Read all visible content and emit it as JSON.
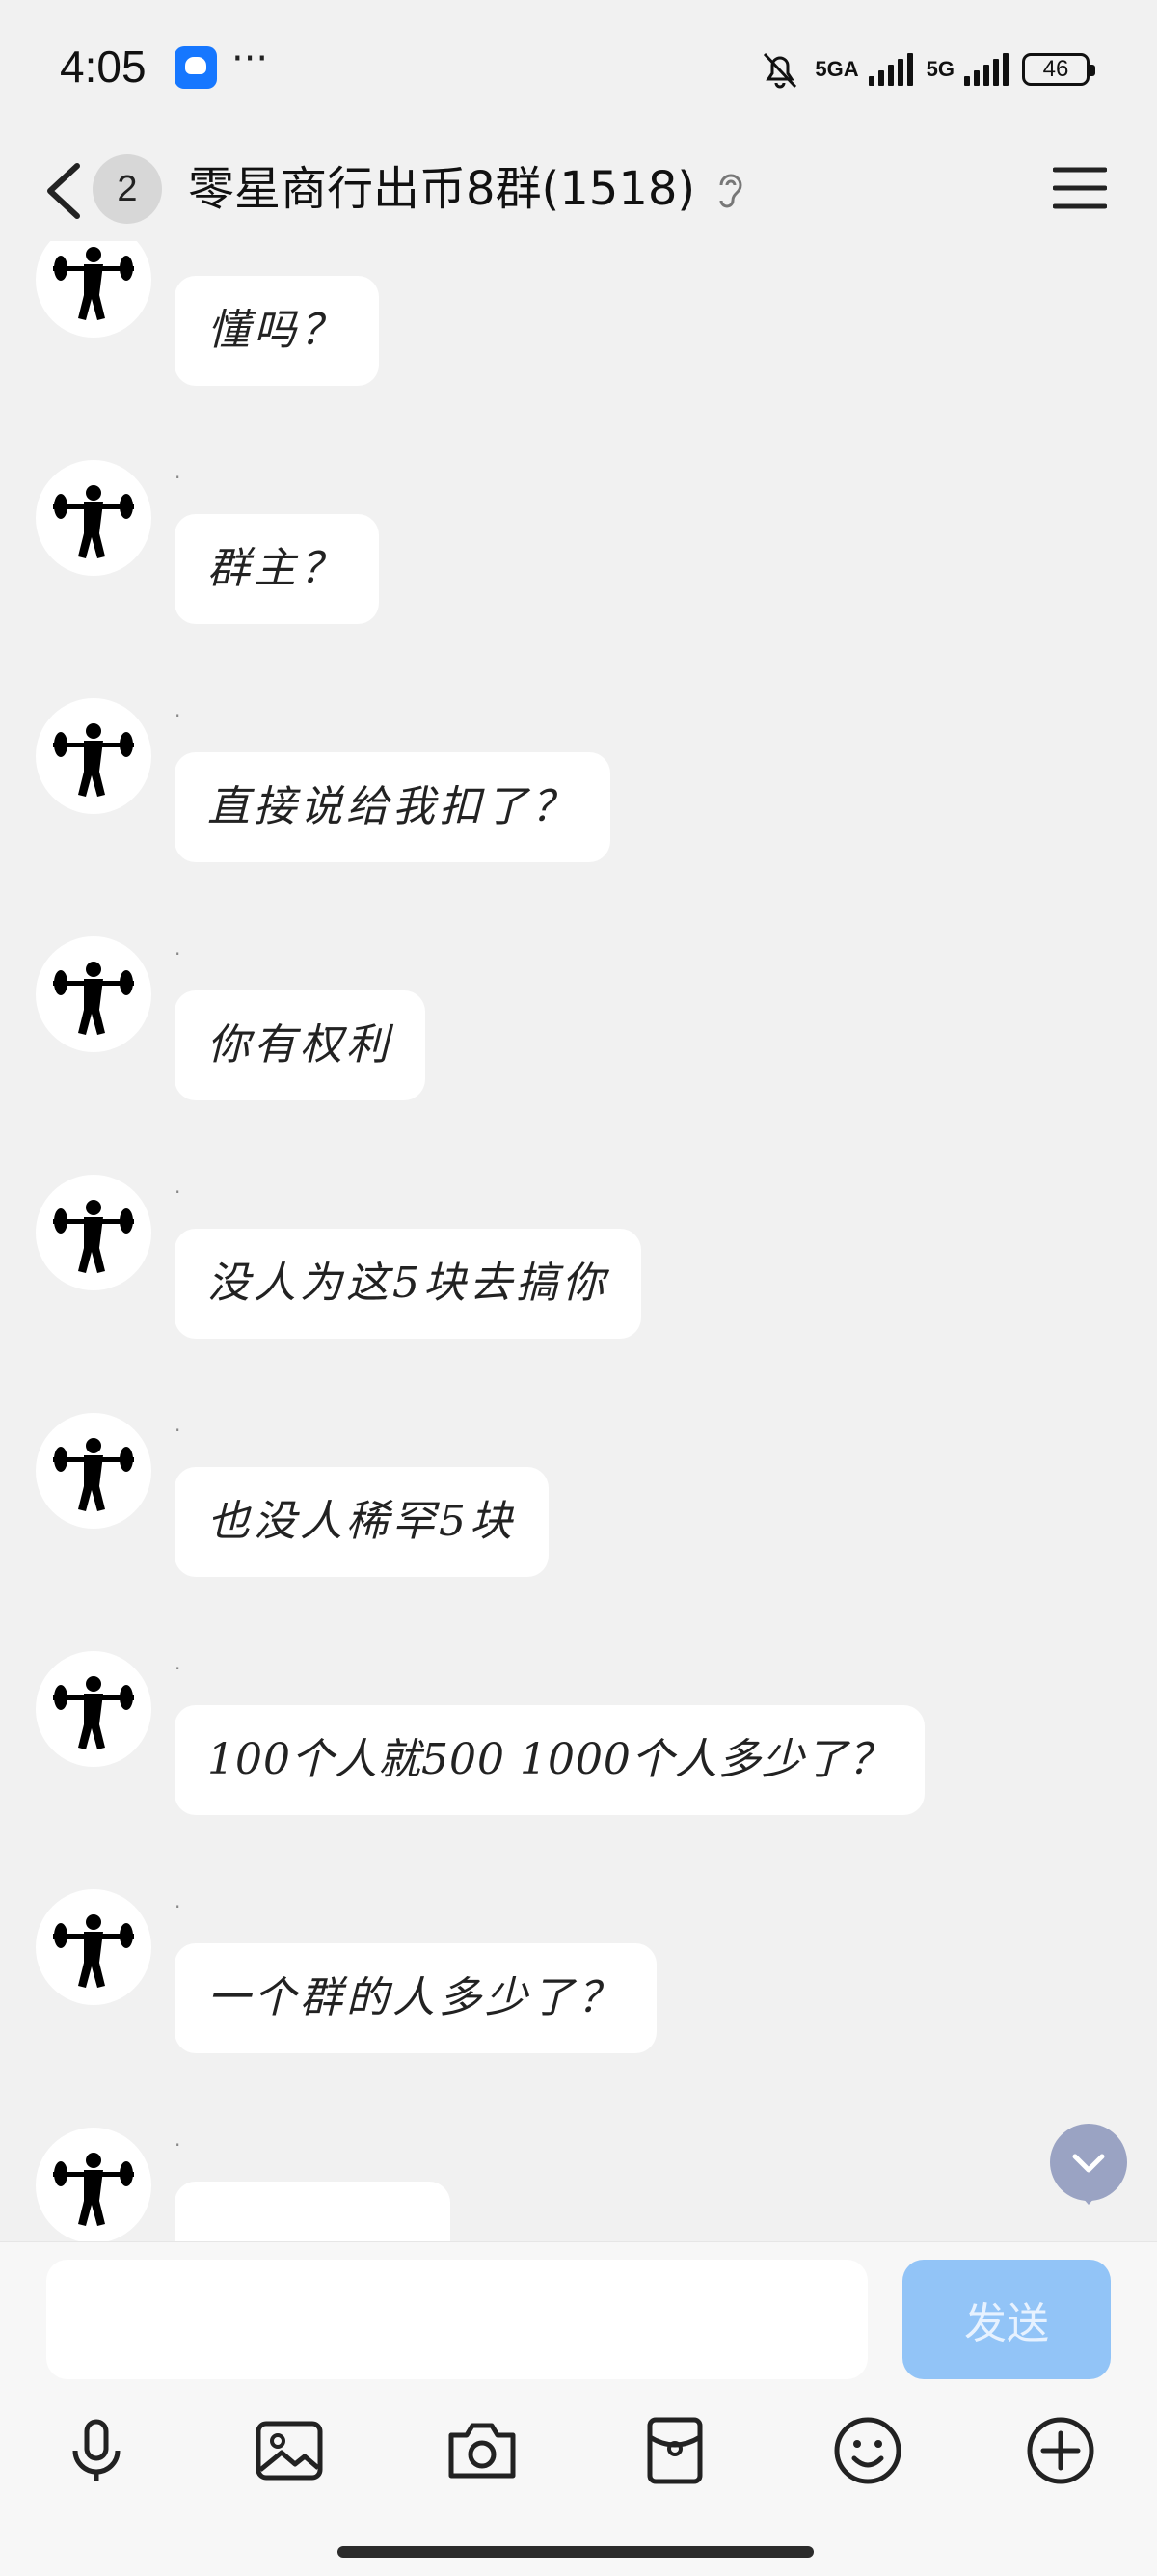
{
  "status": {
    "time": "4:05",
    "more": "···",
    "net1": "5GA",
    "net2": "5G",
    "battery": "46"
  },
  "header": {
    "unread": "2",
    "title": "零星商行出币8群(1518)"
  },
  "messages": [
    {
      "nick": "·",
      "text": "懂吗？"
    },
    {
      "nick": "·",
      "text": "群主？"
    },
    {
      "nick": "·",
      "text": "直接说给我扣了？"
    },
    {
      "nick": "·",
      "text": "你有权利"
    },
    {
      "nick": "·",
      "text": "没人为这5块去搞你"
    },
    {
      "nick": "·",
      "text": "也没人稀罕5块"
    },
    {
      "nick": "·",
      "text": "100个人就500 1000个人多少了？"
    },
    {
      "nick": "·",
      "text": "一个群的人多少了？"
    },
    {
      "nick": "·",
      "text": ""
    }
  ],
  "composer": {
    "value": "",
    "send_label": "发送"
  },
  "icons": [
    "microphone-icon",
    "image-icon",
    "camera-icon",
    "red-packet-icon",
    "emoji-icon",
    "plus-icon"
  ]
}
